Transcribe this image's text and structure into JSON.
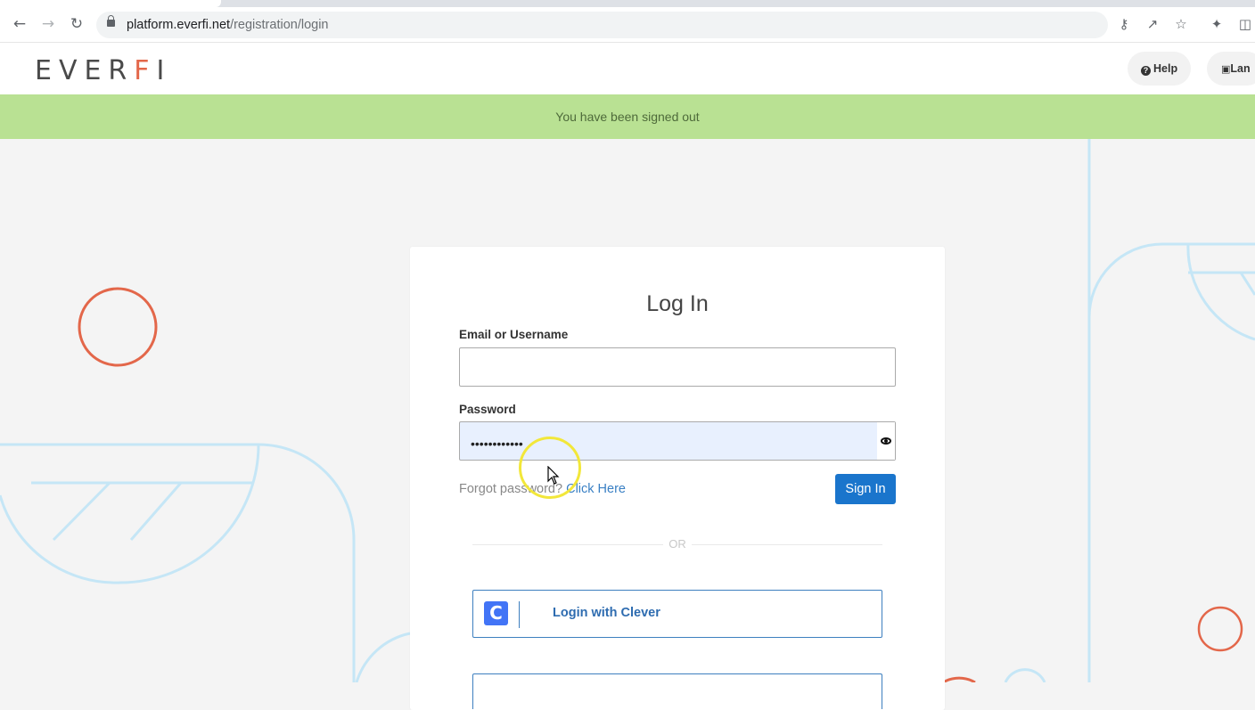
{
  "browser": {
    "url_host": "platform.everfi.net",
    "url_path": "/registration/login"
  },
  "header": {
    "logo_text_a": "EVER",
    "logo_text_b": "F",
    "logo_text_c": "I",
    "help_label": "Help",
    "language_label": "Lan"
  },
  "banner": {
    "message": "You have been signed out"
  },
  "login": {
    "title": "Log In",
    "email_label": "Email or Username",
    "email_value": "",
    "password_label": "Password",
    "password_value": "••••••••••••",
    "forgot_text": "Forgot password? ",
    "forgot_link": "Click Here",
    "signin_label": "Sign In",
    "or_text": "OR",
    "clever_logo": "C",
    "clever_label": "Login with Clever"
  },
  "colors": {
    "brand_accent": "#e3674a",
    "banner_bg": "#b9e193",
    "primary_button": "#1a75cc",
    "deco_line": "#c5e6f6"
  }
}
